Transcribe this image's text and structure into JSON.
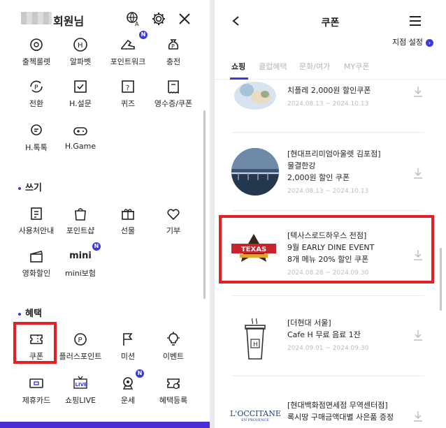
{
  "left": {
    "greeting": "회원님",
    "icons": {
      "translate": "translate-icon",
      "settings": "gear-icon",
      "close": "close-icon"
    },
    "grid1": [
      {
        "label": "출첵룰렛",
        "icon": "roulette-icon"
      },
      {
        "label": "알파벳",
        "icon": "alphabet-icon"
      },
      {
        "label": "포인트워크",
        "icon": "sneaker-icon",
        "badge": "N"
      },
      {
        "label": "충전",
        "icon": "money-bag-icon"
      },
      {
        "label": "전환",
        "icon": "point-convert-icon"
      },
      {
        "label": "H.설문",
        "icon": "survey-icon"
      },
      {
        "label": "퀴즈",
        "icon": "quiz-icon"
      },
      {
        "label": "영수증/쿠폰",
        "icon": "receipt-icon"
      },
      {
        "label": "H.톡톡",
        "icon": "chat-icon"
      },
      {
        "label": "H.Game",
        "icon": "gamepad-icon"
      }
    ],
    "section_write": "쓰기",
    "grid2": [
      {
        "label": "사용처안내",
        "icon": "store-guide-icon"
      },
      {
        "label": "포인트샵",
        "icon": "shopping-bag-icon"
      },
      {
        "label": "선물",
        "icon": "gift-icon"
      },
      {
        "label": "기부",
        "icon": "heart-icon"
      },
      {
        "label": "영화할인",
        "icon": "clapper-icon"
      },
      {
        "label": "mini보험",
        "icon": "mini-insurance-icon",
        "icon_text": "mini",
        "badge": "N"
      }
    ],
    "section_benefit": "혜택",
    "grid3": [
      {
        "label": "쿠폰",
        "icon": "coupon-icon"
      },
      {
        "label": "플러스포인트",
        "icon": "plus-point-icon"
      },
      {
        "label": "미션",
        "icon": "flag-icon"
      },
      {
        "label": "이벤트",
        "icon": "bulb-icon"
      },
      {
        "label": "제휴카드",
        "icon": "card-icon"
      },
      {
        "label": "쇼핑LIVE",
        "icon": "live-icon",
        "icon_text": "LIVE"
      },
      {
        "label": "운세",
        "icon": "fortune-icon",
        "badge": "N"
      },
      {
        "label": "혜택등록",
        "icon": "ticket-register-icon"
      }
    ]
  },
  "right": {
    "title": "쿠폰",
    "branch_setting": "지점 설정",
    "branch_arrow": "›",
    "tabs": [
      "쇼핑",
      "클럽혜택",
      "문화/여가",
      "MY쿠폰"
    ],
    "active_tab": 0,
    "coupons": [
      {
        "lines": [
          "치플레 2,000원 할인쿠폰"
        ],
        "date": "2024.08.13 ~ 2024.10.13",
        "image": "food-plate-image"
      },
      {
        "lines": [
          "[현대프리미엄아울렛 김포점]",
          "물결한강",
          "2,000원 할인 쿠폰"
        ],
        "date": "2024.08.13 ~ 2024.10.13",
        "image": "river-bridge-image"
      },
      {
        "lines": [
          "[텍사스로드하우스 전점]",
          "9월 EARLY DINE EVENT",
          "8개 메뉴 20% 할인 쿠폰"
        ],
        "date": "2024.08.28 ~ 2024.09.30",
        "image": "texas-roadhouse-logo",
        "logo_text": "TEXAS"
      },
      {
        "lines": [
          "[더현대 서울]",
          "Cafe H 무료 음료 1잔"
        ],
        "date": "2024.09.01 ~ 2024.09.30",
        "image": "coffee-cup-image"
      },
      {
        "lines": [
          "[현대백화점면세점 무역센터점]",
          "록시땅 구매금액대별 사은품 증정"
        ],
        "date": "",
        "image": "loccitane-logo",
        "logo_text": "L'OCCITANE",
        "logo_sub": "EN PROVENCE"
      }
    ],
    "colors": {
      "accent": "#3b3bdc",
      "highlight": "#e32026"
    }
  }
}
